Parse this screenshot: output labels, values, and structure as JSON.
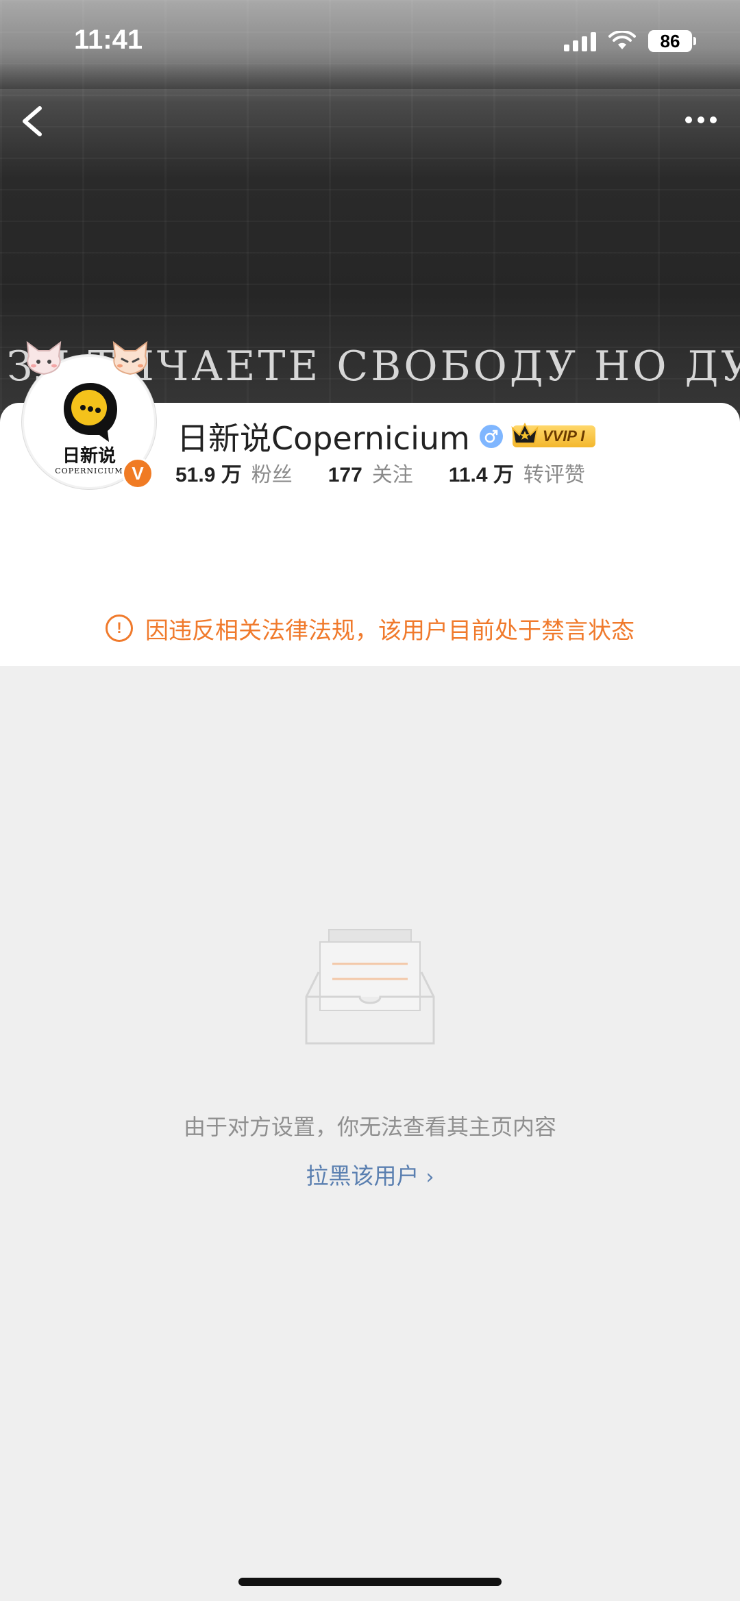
{
  "status_bar": {
    "time": "11:41",
    "battery": "86"
  },
  "cover": {
    "graffiti_text": "ЗЛ ТИЧАЕТЕ СВОБОДУ НО ДУ"
  },
  "profile": {
    "avatar_cn": "日新说",
    "avatar_en": "COPERNICIUM",
    "verified_badge": "V",
    "name": "日新说Copernicium",
    "gender": "male",
    "vip_label": "VVIP I",
    "stats": [
      {
        "value": "51.9 万",
        "label": "粉丝"
      },
      {
        "value": "177",
        "label": "关注"
      },
      {
        "value": "11.4 万",
        "label": "转评赞"
      }
    ]
  },
  "notice": {
    "icon": "!",
    "text": "因违反相关法律法规，该用户目前处于禁言状态"
  },
  "empty_state": {
    "message": "由于对方设置，你无法查看其主页内容",
    "link_label": "拉黑该用户"
  },
  "colors": {
    "accent_orange": "#f07a2c",
    "link_blue": "#5a7fb0",
    "vip_gold": "#f3b72d"
  }
}
